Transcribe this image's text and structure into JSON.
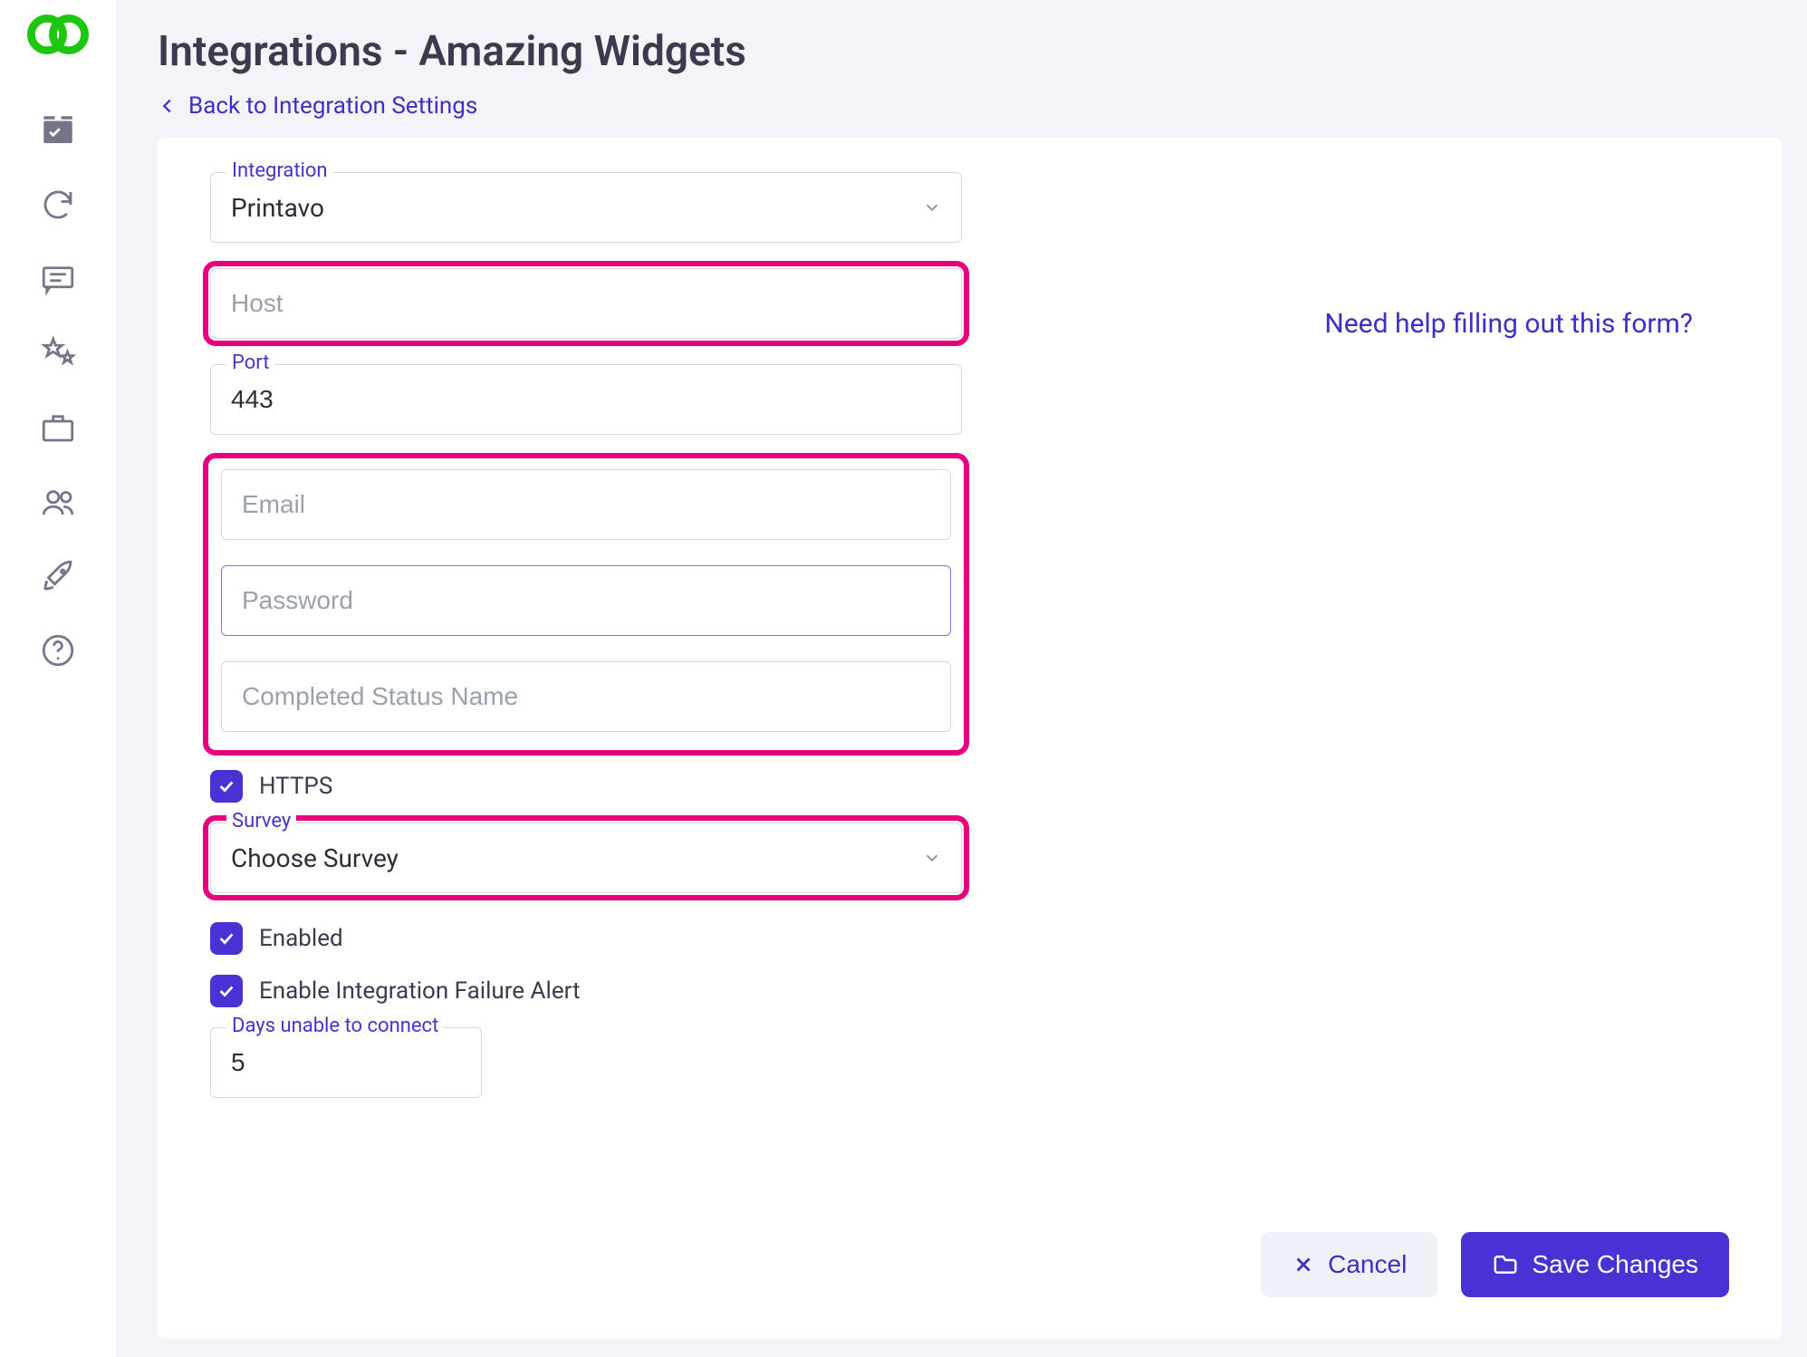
{
  "header": {
    "title": "Integrations - Amazing Widgets",
    "back_link": "Back to Integration Settings"
  },
  "help": {
    "link_text": "Need help filling out this form?"
  },
  "fields": {
    "integration": {
      "label": "Integration",
      "value": "Printavo"
    },
    "host": {
      "placeholder": "Host",
      "value": ""
    },
    "port": {
      "label": "Port",
      "value": "443"
    },
    "email": {
      "placeholder": "Email",
      "value": ""
    },
    "password": {
      "placeholder": "Password",
      "value": ""
    },
    "completed_status": {
      "placeholder": "Completed Status Name",
      "value": ""
    },
    "https": {
      "label": "HTTPS",
      "checked": true
    },
    "survey": {
      "label": "Survey",
      "value": "Choose Survey"
    },
    "enabled": {
      "label": "Enabled",
      "checked": true
    },
    "failure_alert": {
      "label": "Enable Integration Failure Alert",
      "checked": true
    },
    "days_unable": {
      "label": "Days unable to connect",
      "value": "5"
    }
  },
  "actions": {
    "cancel": "Cancel",
    "save": "Save Changes"
  },
  "sidebar_icons": [
    "dashboard-icon",
    "sync-icon",
    "chat-icon",
    "star-icon",
    "briefcase-icon",
    "users-icon",
    "rocket-icon",
    "help-icon"
  ]
}
